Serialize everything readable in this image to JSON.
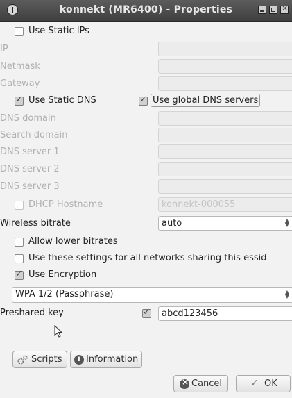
{
  "window": {
    "title": "konnekt (MR6400) - Properties"
  },
  "static_ips": {
    "label": "Use Static IPs",
    "checked": false
  },
  "ip": {
    "label": "IP",
    "value": ""
  },
  "netmask": {
    "label": "Netmask",
    "value": ""
  },
  "gateway": {
    "label": "Gateway",
    "value": ""
  },
  "static_dns": {
    "label": "Use Static DNS",
    "checked": true
  },
  "global_dns": {
    "label": "Use global DNS servers",
    "checked": true
  },
  "dns_domain": {
    "label": "DNS domain",
    "value": ""
  },
  "search_domain": {
    "label": "Search domain",
    "value": ""
  },
  "dns_server_1": {
    "label": "DNS server 1",
    "value": ""
  },
  "dns_server_2": {
    "label": "DNS server 2",
    "value": ""
  },
  "dns_server_3": {
    "label": "DNS server 3",
    "value": ""
  },
  "dhcp_hostname": {
    "label": "DHCP Hostname",
    "value": "konnekt-000055",
    "checked": false
  },
  "wireless_bitrate": {
    "label": "Wireless bitrate",
    "value": "auto"
  },
  "allow_lower": {
    "label": "Allow lower bitrates",
    "checked": false
  },
  "share_settings": {
    "label": "Use these settings for all networks sharing this essid",
    "checked": false
  },
  "use_encryption": {
    "label": "Use Encryption",
    "checked": true
  },
  "encryption_type": {
    "value": "WPA 1/2 (Passphrase)"
  },
  "preshared": {
    "label": "Preshared key",
    "value": "abcd123456",
    "checked": true
  },
  "buttons": {
    "scripts": "Scripts",
    "information": "Information",
    "cancel": "Cancel",
    "ok": "OK"
  }
}
